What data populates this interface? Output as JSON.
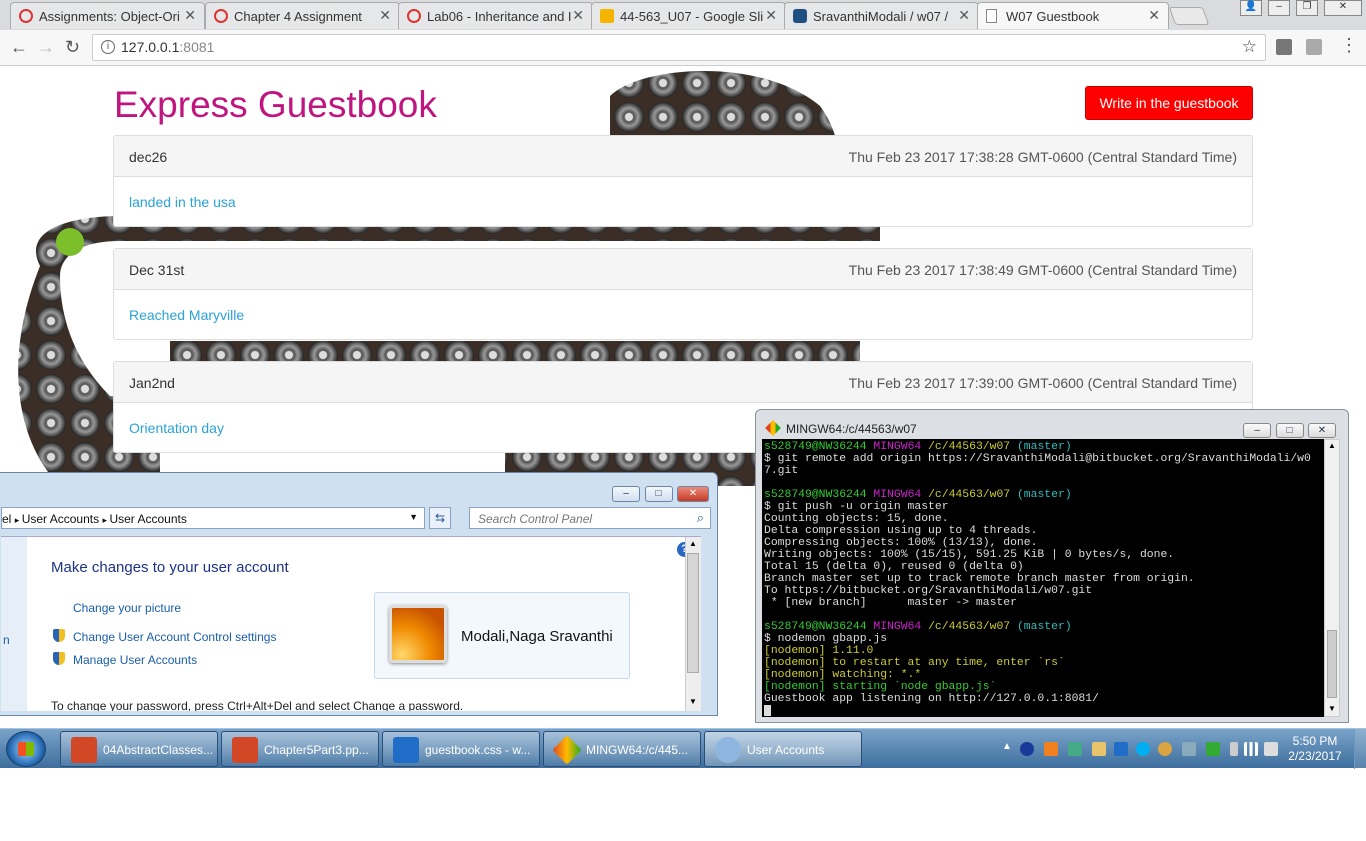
{
  "browser": {
    "tabs": [
      {
        "title": "Assignments: Object-Ori",
        "icon": "canvas-icon"
      },
      {
        "title": "Chapter 4 Assignment",
        "icon": "canvas-icon"
      },
      {
        "title": "Lab06 - Inheritance and I",
        "icon": "canvas-icon"
      },
      {
        "title": "44-563_U07 - Google Sli",
        "icon": "slides-icon"
      },
      {
        "title": "SravanthiModali / w07 /",
        "icon": "bitbucket-icon"
      },
      {
        "title": "W07 Guestbook",
        "icon": "page-icon"
      }
    ],
    "url_host": "127.0.0.1",
    "url_port": ":8081"
  },
  "site": {
    "title": "Express Guestbook",
    "write_button": "Write in the guestbook",
    "entries": [
      {
        "name": "dec26",
        "date": "Thu Feb 23 2017 17:38:28 GMT-0600 (Central Standard Time)",
        "body": "landed in the usa"
      },
      {
        "name": "Dec 31st",
        "date": "Thu Feb 23 2017 17:38:49 GMT-0600 (Central Standard Time)",
        "body": "Reached Maryville"
      },
      {
        "name": "Jan2nd",
        "date": "Thu Feb 23 2017 17:39:00 GMT-0600 (Central Standard Time)",
        "body": "Orientation day"
      }
    ]
  },
  "user_accounts": {
    "breadcrumb_partial": "el",
    "breadcrumb_1": "User Accounts",
    "breadcrumb_2": "User Accounts",
    "search_placeholder": "Search Control Panel",
    "heading": "Make changes to your user account",
    "link_picture": "Change your picture",
    "link_uac": "Change User Account Control settings",
    "link_manage": "Manage User Accounts",
    "username": "Modali,Naga Sravanthi",
    "cut_text": "To change your password, press Ctrl+Alt+Del and select Change a password.",
    "left_partial": "n"
  },
  "terminal": {
    "title": "MINGW64:/c/44563/w07",
    "prompt_user": "s528749@NW36244",
    "prompt_host": "MINGW64",
    "prompt_path": "/c/44563/w07",
    "prompt_branch": "(master)",
    "cmd1": "$ git remote add origin https://SravanthiModali@bitbucket.org/SravanthiModali/w0",
    "cmd1b": "7.git",
    "cmd2": "$ git push -u origin master",
    "out2": [
      "Counting objects: 15, done.",
      "Delta compression using up to 4 threads.",
      "Compressing objects: 100% (13/13), done.",
      "Writing objects: 100% (15/15), 591.25 KiB | 0 bytes/s, done.",
      "Total 15 (delta 0), reused 0 (delta 0)",
      "Branch master set up to track remote branch master from origin.",
      "To https://bitbucket.org/SravanthiModali/w07.git",
      " * [new branch]      master -> master"
    ],
    "cmd3": "$ nodemon gbapp.js",
    "out3": [
      "[nodemon] 1.11.0",
      "[nodemon] to restart at any time, enter `rs`",
      "[nodemon] watching: *.*",
      "[nodemon] starting `node gbapp.js`"
    ],
    "listening": "Guestbook app listening on http://127.0.0.1:8081/"
  },
  "taskbar": {
    "items": [
      {
        "label": "04AbstractClasses...",
        "icon": "powerpoint-icon"
      },
      {
        "label": "Chapter5Part3.pp...",
        "icon": "powerpoint-icon"
      },
      {
        "label": "guestbook.css - w...",
        "icon": "vscode-icon"
      },
      {
        "label": "MINGW64:/c/445...",
        "icon": "git-bash-icon"
      },
      {
        "label": "User Accounts",
        "icon": "user-accounts-icon"
      }
    ],
    "time": "5:50 PM",
    "date": "2/23/2017"
  }
}
